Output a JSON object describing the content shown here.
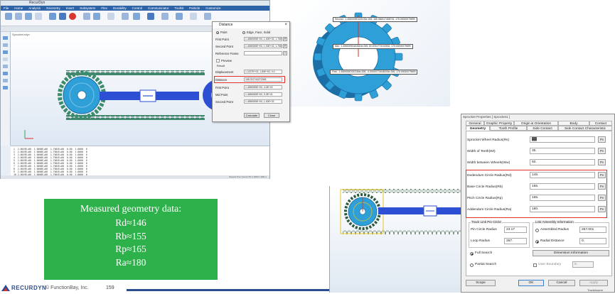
{
  "app": {
    "title": "RecurDyn",
    "tabs": [
      "File",
      "Home",
      "Analysis",
      "Geometry",
      "Insert",
      "Subsystem",
      "Flex",
      "Durability",
      "Control",
      "Communicator",
      "Toolkit",
      "Particle",
      "Customize"
    ],
    "view_tab": "Sprocket.rdyn",
    "output_lines": [
      "1  2.0019E+00  1.0000E+00  1.7001E+00  0.00  1.0000  0",
      "2  2.0019E+00  1.0000E+00  1.7001E+00  0.00  1.0000  0",
      "3  2.0019E+00  1.0000E+00  1.7001E+00  0.00  1.0000  0",
      "4  2.0019E+00  1.0000E+00  1.7001E+00  0.00  1.0000  0",
      "5  2.0019E+00  1.0000E+00  1.7001E+00  0.00  1.0000  0",
      "6  2.0019E+00  1.0000E+00  1.7001E+00  0.00  1.0000  0",
      "7  2.0019E+00  1.0000E+00  1.7001E+00  0.00  1.0000  0",
      "8  2.0019E+00  1.0000E+00  1.7001E+00  0.00  1.0000  0",
      "9  2.0019E+00  1.0000E+00  1.7001E+00  0.00  1.0000  0",
      "10 2.0019E+00  1.0000E+00  1.7001E+00  0.00  1.0000  0"
    ],
    "status": "Repeat  Tree  Cursor  PN  1.0000  1.00E-1"
  },
  "distance_dialog": {
    "title": "Distance",
    "close": "×",
    "mode_point": "Point",
    "mode_edge": "Edge, Face, Solid",
    "first_point_label": "First Point",
    "first_point_value": "1.4550059E+00, 1.00E+02, 1.75E+02",
    "second_point_label": "Second Point",
    "second_point_value": "1.4550059E+00, 1.00E+02, 1.75E+02",
    "pick_label": "P",
    "ref_frame_label": "Reference Frame",
    "ref_frame_btn": "?",
    "preview_label": "Preview",
    "result_label": "Result",
    "displacement_label": "Displacement",
    "displacement_value": "1.2227E+02, 1.80E+02, 0.0",
    "distance_label": "Distance",
    "distance_value": "165.021744271506",
    "first_point2_label": "First Point",
    "first_point2_value": "1.4550059E+00, 4.0E+02",
    "mid_point_label": "Mid Point",
    "mid_point_value": "1.4550059E+00, 9.0E+01",
    "second_point2_label": "Second Point",
    "second_point2_value": "1.4550059E+00, 1.00E+02",
    "calculate_btn": "Calculate",
    "close_btn": "Close"
  },
  "gear_annotations": {
    "second": "Second : 1.45500090100130e-005, 165.356317468751, 175.00000079699",
    "mid": "Mid : 1.45500090402814e-005, 82.6781773102532, 175.00000079699",
    "first": "First : 1.45500087002184e-005, -0.00000774048200e-006, 175.00000079699"
  },
  "note": {
    "heading": "Measured geometry data:",
    "lines": [
      "Rd≈146",
      "Rb≈155",
      "Rp≈165",
      "Ra≈180"
    ]
  },
  "footer": {
    "brand": "RECURDYN",
    "copyright": "© FunctionBay, Inc.",
    "page": "159"
  },
  "properties_dialog": {
    "header_text": "Sprocket Properties [ Sprocket1 ]",
    "tabs_row1": [
      "General",
      "Graphic Property",
      "Origin & Orientation",
      "Body",
      "Contact"
    ],
    "tabs_row2": [
      "Geometry",
      "Tooth Profile",
      "Side Contact",
      "Side Contact Characteristic"
    ],
    "fields": [
      {
        "label": "Sprocket Wheel Radius(Rs)",
        "value": "▓▓"
      },
      {
        "label": "Width of Teeth(Wt)",
        "value": "35."
      },
      {
        "label": "Width between Wheels(Ww)",
        "value": "50."
      },
      {
        "label": "Dedendum Circle Radius(Rd)",
        "value": "146."
      },
      {
        "label": "Base Circle Radius(Rb)",
        "value": "155."
      },
      {
        "label": "Pitch Circle Radius(Rp)",
        "value": "165."
      },
      {
        "label": "Addendum Circle Radius(Ra)",
        "value": "180."
      }
    ],
    "pf_label": "Pv",
    "track_group": "Track Link Pin Circle",
    "pin_circle_label": "Pin Circle Radius",
    "pin_circle_value": "23.17",
    "loop_radius_label": "Loop Radius",
    "loop_radius_value": "267.",
    "link_group": "Link Assembly Information",
    "assembled_radius_label": "Assembled Radius",
    "assembled_radius_value": "267.001",
    "radial_distance_label": "Radial Distance",
    "radial_distance_value": "0.",
    "full_search_label": "Full Search",
    "partial_search_label": "Partial Search",
    "dimension_info_btn": "Dimension Information",
    "user_boundary_label": "User Boundary",
    "user_boundary_value": "0.",
    "scope_btn": "Scope",
    "ok_btn": "OK",
    "cancel_btn": "Cancel",
    "apply_btn": "Apply",
    "under_text": "TrackAssem"
  },
  "colors": {
    "sprocket": "#2f9fd8",
    "note_bg": "#2db14a",
    "highlight_red": "#e0302a",
    "body_blue": "#2d4fd4"
  }
}
